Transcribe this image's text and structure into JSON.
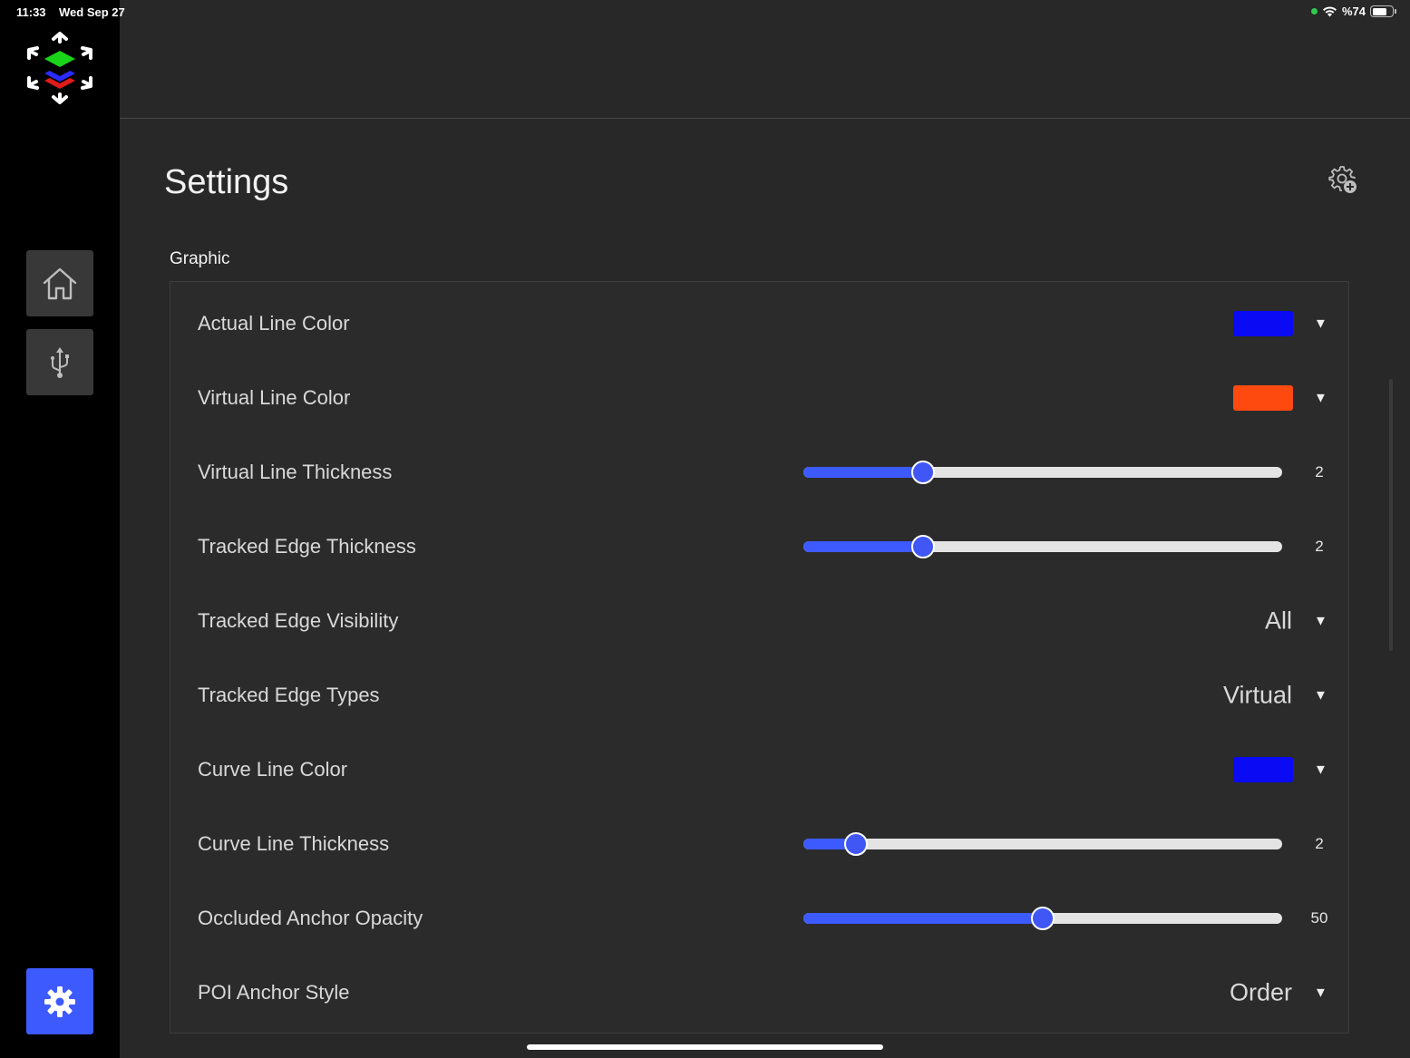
{
  "status_bar": {
    "time": "11:33",
    "date": "Wed Sep 27",
    "battery": "%74",
    "battery_level": 0.74
  },
  "sidebar": {
    "items": [
      {
        "icon": "home-icon",
        "active": false
      },
      {
        "icon": "usb-icon",
        "active": false
      },
      {
        "icon": "gear-icon",
        "active": true
      }
    ],
    "active_color": "#3d5afe"
  },
  "header": {
    "title": "Settings",
    "action_icon": "gear-plus-icon"
  },
  "section": {
    "title": "Graphic"
  },
  "settings": [
    {
      "label": "Actual Line Color",
      "type": "color",
      "value": "#0a0af5"
    },
    {
      "label": "Virtual Line Color",
      "type": "color",
      "value": "#ff4a0f"
    },
    {
      "label": "Virtual Line Thickness",
      "type": "slider",
      "value": "2",
      "fill": 0.25
    },
    {
      "label": "Tracked Edge Thickness",
      "type": "slider",
      "value": "2",
      "fill": 0.25
    },
    {
      "label": "Tracked Edge Visibility",
      "type": "select",
      "value": "All"
    },
    {
      "label": "Tracked Edge Types",
      "type": "select",
      "value": "Virtual"
    },
    {
      "label": "Curve Line Color",
      "type": "color",
      "value": "#0a0af5"
    },
    {
      "label": "Curve Line Thickness",
      "type": "slider",
      "value": "2",
      "fill": 0.11
    },
    {
      "label": "Occluded Anchor Opacity",
      "type": "slider",
      "value": "50",
      "fill": 0.5
    },
    {
      "label": "POI Anchor Style",
      "type": "select",
      "value": "Order"
    }
  ],
  "accent_color": "#3d5afe",
  "dropdown_arrow": "▼"
}
